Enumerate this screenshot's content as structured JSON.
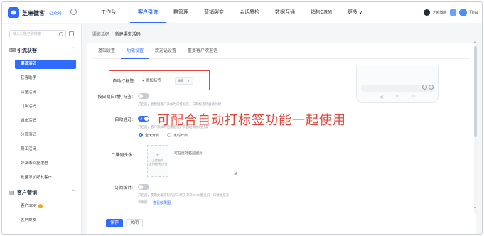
{
  "colors": {
    "accent": "#2f6bff",
    "annotation": "#e0483c"
  },
  "topbar": {
    "brand": "芝麻微客",
    "brand_extra": "公众号",
    "nav": [
      "工作台",
      "客户引流",
      "群管理",
      "营销裂变",
      "会话质检",
      "数据互通",
      "销售CRM",
      "更多 ∨"
    ],
    "active_nav": "客户引流",
    "user_text": "芝麻微客",
    "user_name": "Tina"
  },
  "sidebar": {
    "search_placeholder": "输入功能名称搜索",
    "group1_title": "引流获客",
    "group1_items": [
      "渠道活码",
      "获客助手",
      "店童活码",
      "门店活码",
      "城市活码",
      "分流活码",
      "员工活码",
      "好友未回复跟进",
      "批量添加好友客户"
    ],
    "active_item": "渠道活码",
    "group2_title": "客户营销",
    "group2_items": [
      "客户SOP",
      "客户群发"
    ]
  },
  "breadcrumb": {
    "parent": "渠道活码",
    "separator": "/",
    "current": "新建渠道活码"
  },
  "tabs": [
    "基础设置",
    "功能设置",
    "欢迎语设置",
    "重复客户欢迎语"
  ],
  "active_tab": "功能设置",
  "form": {
    "auto_tag_label": "自动打标签:",
    "add_tag_button": "+ 添加标签",
    "tag_chip": "标签",
    "tag_chip_close": "×",
    "auto_tag_on_add_label": "按日期自动打标签:",
    "auto_tag_hint": "开启后，会根据客户添加时间打标签，日期标签将自动创建",
    "auto_pass_label": "自动通过:",
    "auto_pass_state": "开",
    "auto_pass_hint": "开启后，客户添加时无需验证，将自动添加为好友",
    "radio_all_day": "全天开启",
    "radio_scheduled": "定时开启",
    "qr_avatar_label": "二维码头像:",
    "upload_text_1": "上传图片",
    "upload_text_2": "(支持拖拽上传)",
    "paste_text": "可在此处粘贴图片",
    "daily_stats_label": "订阅统计:",
    "daily_stats_hint": "开启后，使用此渠道码的员工将于次日09:00推送前一日数据报表",
    "example_label": "示例图",
    "example_link": "查看效果图"
  },
  "overlay_annotation": "可配合自动打标签功能一起使用",
  "footer": {
    "save": "保存",
    "close": "关闭"
  }
}
